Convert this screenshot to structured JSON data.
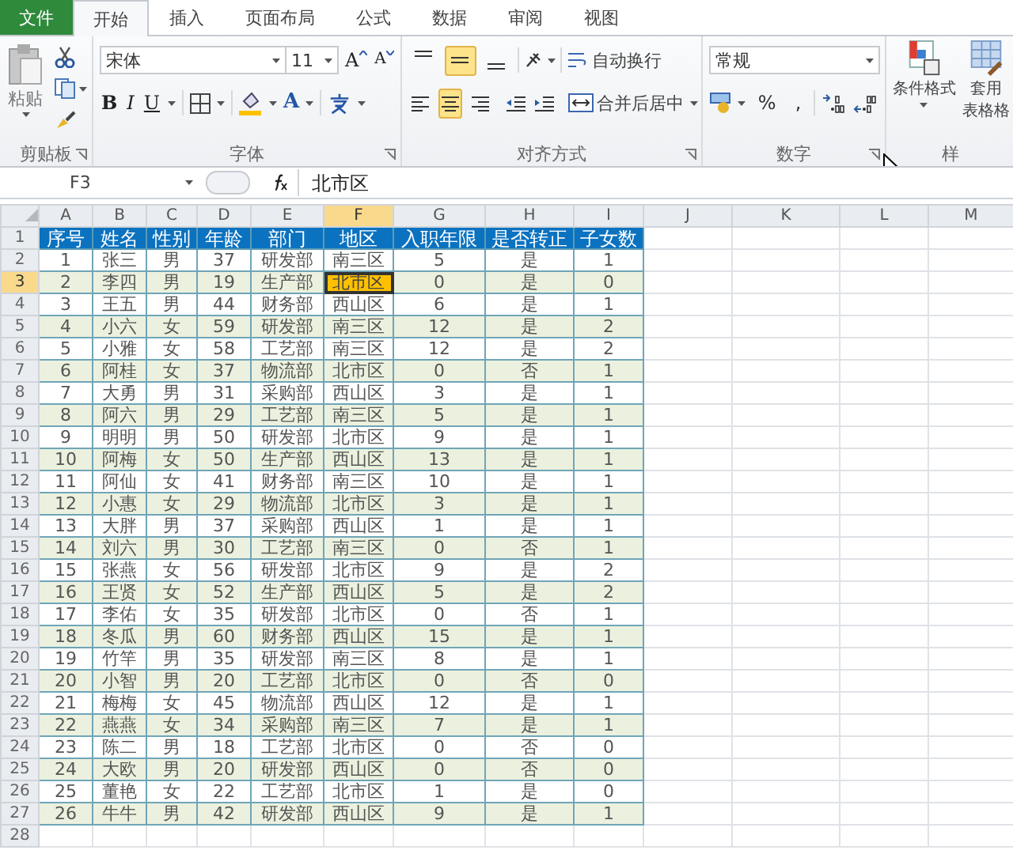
{
  "tabs": [
    {
      "label": "文件",
      "kind": "file",
      "selected": false
    },
    {
      "label": "开始",
      "kind": "tab",
      "selected": true
    },
    {
      "label": "插入",
      "kind": "tab",
      "selected": false
    },
    {
      "label": "页面布局",
      "kind": "tab",
      "selected": false
    },
    {
      "label": "公式",
      "kind": "tab",
      "selected": false
    },
    {
      "label": "数据",
      "kind": "tab",
      "selected": false
    },
    {
      "label": "审阅",
      "kind": "tab",
      "selected": false
    },
    {
      "label": "视图",
      "kind": "tab",
      "selected": false
    }
  ],
  "ribbon": {
    "clipboard": {
      "paste": "粘贴",
      "label": "剪贴板"
    },
    "font": {
      "font_name": "宋体",
      "font_size": "11",
      "grow": "A",
      "shrink": "A",
      "bold": "B",
      "italic": "I",
      "underline": "U",
      "font_color": "A",
      "label": "字体"
    },
    "alignment": {
      "vertical": [
        {
          "kind": "top",
          "selected": false
        },
        {
          "kind": "middle",
          "selected": true
        },
        {
          "kind": "bottom",
          "selected": false
        }
      ],
      "horizontal": [
        {
          "kind": "left",
          "selected": false
        },
        {
          "kind": "center",
          "selected": true
        },
        {
          "kind": "right",
          "selected": false
        }
      ],
      "wrap_text": "自动换行",
      "merge_center": "合并后居中",
      "label": "对齐方式"
    },
    "number": {
      "format": "常规",
      "percent": "%",
      "comma": ",",
      "label": "数字"
    },
    "styles": {
      "conditional": "条件格式",
      "table_format_lines": [
        "套用",
        "表格格"
      ],
      "label": "样"
    }
  },
  "formula_bar": {
    "name_box": "F3",
    "formula": "北市区"
  },
  "sheet": {
    "columns": [
      {
        "label": "A",
        "selected": false
      },
      {
        "label": "B",
        "selected": false
      },
      {
        "label": "C",
        "selected": false
      },
      {
        "label": "D",
        "selected": false
      },
      {
        "label": "E",
        "selected": false
      },
      {
        "label": "F",
        "selected": true
      },
      {
        "label": "G",
        "selected": false
      },
      {
        "label": "H",
        "selected": false
      },
      {
        "label": "I",
        "selected": false
      },
      {
        "label": "J",
        "selected": false
      },
      {
        "label": "K",
        "selected": false
      },
      {
        "label": "L",
        "selected": false
      },
      {
        "label": "M",
        "selected": false
      }
    ],
    "rows": [
      {
        "number": "1",
        "kind": "header",
        "selected": false,
        "cells": [
          "序号",
          "姓名",
          "性别",
          "年龄",
          "部门",
          "地区",
          "入职年限",
          "是否转正",
          "子女数"
        ]
      },
      {
        "number": "2",
        "kind": "data",
        "selected": false,
        "cells": [
          "1",
          "张三",
          "男",
          "37",
          "研发部",
          "南三区",
          "5",
          "是",
          "1"
        ]
      },
      {
        "number": "3",
        "kind": "data",
        "selected": true,
        "cells": [
          "2",
          "李四",
          "男",
          "19",
          "生产部",
          "北市区",
          "0",
          "是",
          "0"
        ]
      },
      {
        "number": "4",
        "kind": "data",
        "selected": false,
        "cells": [
          "3",
          "王五",
          "男",
          "44",
          "财务部",
          "西山区",
          "6",
          "是",
          "1"
        ]
      },
      {
        "number": "5",
        "kind": "data",
        "selected": false,
        "cells": [
          "4",
          "小六",
          "女",
          "59",
          "研发部",
          "南三区",
          "12",
          "是",
          "2"
        ]
      },
      {
        "number": "6",
        "kind": "data",
        "selected": false,
        "cells": [
          "5",
          "小雅",
          "女",
          "58",
          "工艺部",
          "南三区",
          "12",
          "是",
          "2"
        ]
      },
      {
        "number": "7",
        "kind": "data",
        "selected": false,
        "cells": [
          "6",
          "阿桂",
          "女",
          "37",
          "物流部",
          "北市区",
          "0",
          "否",
          "1"
        ]
      },
      {
        "number": "8",
        "kind": "data",
        "selected": false,
        "cells": [
          "7",
          "大勇",
          "男",
          "31",
          "采购部",
          "西山区",
          "3",
          "是",
          "1"
        ]
      },
      {
        "number": "9",
        "kind": "data",
        "selected": false,
        "cells": [
          "8",
          "阿六",
          "男",
          "29",
          "工艺部",
          "南三区",
          "5",
          "是",
          "1"
        ]
      },
      {
        "number": "10",
        "kind": "data",
        "selected": false,
        "cells": [
          "9",
          "明明",
          "男",
          "50",
          "研发部",
          "北市区",
          "9",
          "是",
          "1"
        ]
      },
      {
        "number": "11",
        "kind": "data",
        "selected": false,
        "cells": [
          "10",
          "阿梅",
          "女",
          "50",
          "生产部",
          "西山区",
          "13",
          "是",
          "1"
        ]
      },
      {
        "number": "12",
        "kind": "data",
        "selected": false,
        "cells": [
          "11",
          "阿仙",
          "女",
          "41",
          "财务部",
          "南三区",
          "10",
          "是",
          "1"
        ]
      },
      {
        "number": "13",
        "kind": "data",
        "selected": false,
        "cells": [
          "12",
          "小惠",
          "女",
          "29",
          "物流部",
          "北市区",
          "3",
          "是",
          "1"
        ]
      },
      {
        "number": "14",
        "kind": "data",
        "selected": false,
        "cells": [
          "13",
          "大胖",
          "男",
          "37",
          "采购部",
          "西山区",
          "1",
          "是",
          "1"
        ]
      },
      {
        "number": "15",
        "kind": "data",
        "selected": false,
        "cells": [
          "14",
          "刘六",
          "男",
          "30",
          "工艺部",
          "南三区",
          "0",
          "否",
          "1"
        ]
      },
      {
        "number": "16",
        "kind": "data",
        "selected": false,
        "cells": [
          "15",
          "张燕",
          "女",
          "56",
          "研发部",
          "北市区",
          "9",
          "是",
          "2"
        ]
      },
      {
        "number": "17",
        "kind": "data",
        "selected": false,
        "cells": [
          "16",
          "王贤",
          "女",
          "52",
          "生产部",
          "西山区",
          "5",
          "是",
          "2"
        ]
      },
      {
        "number": "18",
        "kind": "data",
        "selected": false,
        "cells": [
          "17",
          "李佑",
          "女",
          "35",
          "研发部",
          "北市区",
          "0",
          "否",
          "1"
        ]
      },
      {
        "number": "19",
        "kind": "data",
        "selected": false,
        "cells": [
          "18",
          "冬瓜",
          "男",
          "60",
          "财务部",
          "西山区",
          "15",
          "是",
          "1"
        ]
      },
      {
        "number": "20",
        "kind": "data",
        "selected": false,
        "cells": [
          "19",
          "竹竿",
          "男",
          "35",
          "研发部",
          "南三区",
          "8",
          "是",
          "1"
        ]
      },
      {
        "number": "21",
        "kind": "data",
        "selected": false,
        "cells": [
          "20",
          "小智",
          "男",
          "20",
          "工艺部",
          "北市区",
          "0",
          "否",
          "0"
        ]
      },
      {
        "number": "22",
        "kind": "data",
        "selected": false,
        "cells": [
          "21",
          "梅梅",
          "女",
          "45",
          "物流部",
          "西山区",
          "12",
          "是",
          "1"
        ]
      },
      {
        "number": "23",
        "kind": "data",
        "selected": false,
        "cells": [
          "22",
          "燕燕",
          "女",
          "34",
          "采购部",
          "南三区",
          "7",
          "是",
          "1"
        ]
      },
      {
        "number": "24",
        "kind": "data",
        "selected": false,
        "cells": [
          "23",
          "陈二",
          "男",
          "18",
          "工艺部",
          "北市区",
          "0",
          "否",
          "0"
        ]
      },
      {
        "number": "25",
        "kind": "data",
        "selected": false,
        "cells": [
          "24",
          "大欧",
          "男",
          "20",
          "研发部",
          "西山区",
          "0",
          "否",
          "0"
        ]
      },
      {
        "number": "26",
        "kind": "data",
        "selected": false,
        "cells": [
          "25",
          "董艳",
          "女",
          "22",
          "工艺部",
          "北市区",
          "1",
          "是",
          "0"
        ]
      },
      {
        "number": "27",
        "kind": "data",
        "selected": false,
        "cells": [
          "26",
          "牛牛",
          "男",
          "42",
          "研发部",
          "西山区",
          "9",
          "是",
          "1"
        ]
      },
      {
        "number": "28",
        "kind": "empty",
        "selected": false,
        "cells": []
      }
    ]
  }
}
